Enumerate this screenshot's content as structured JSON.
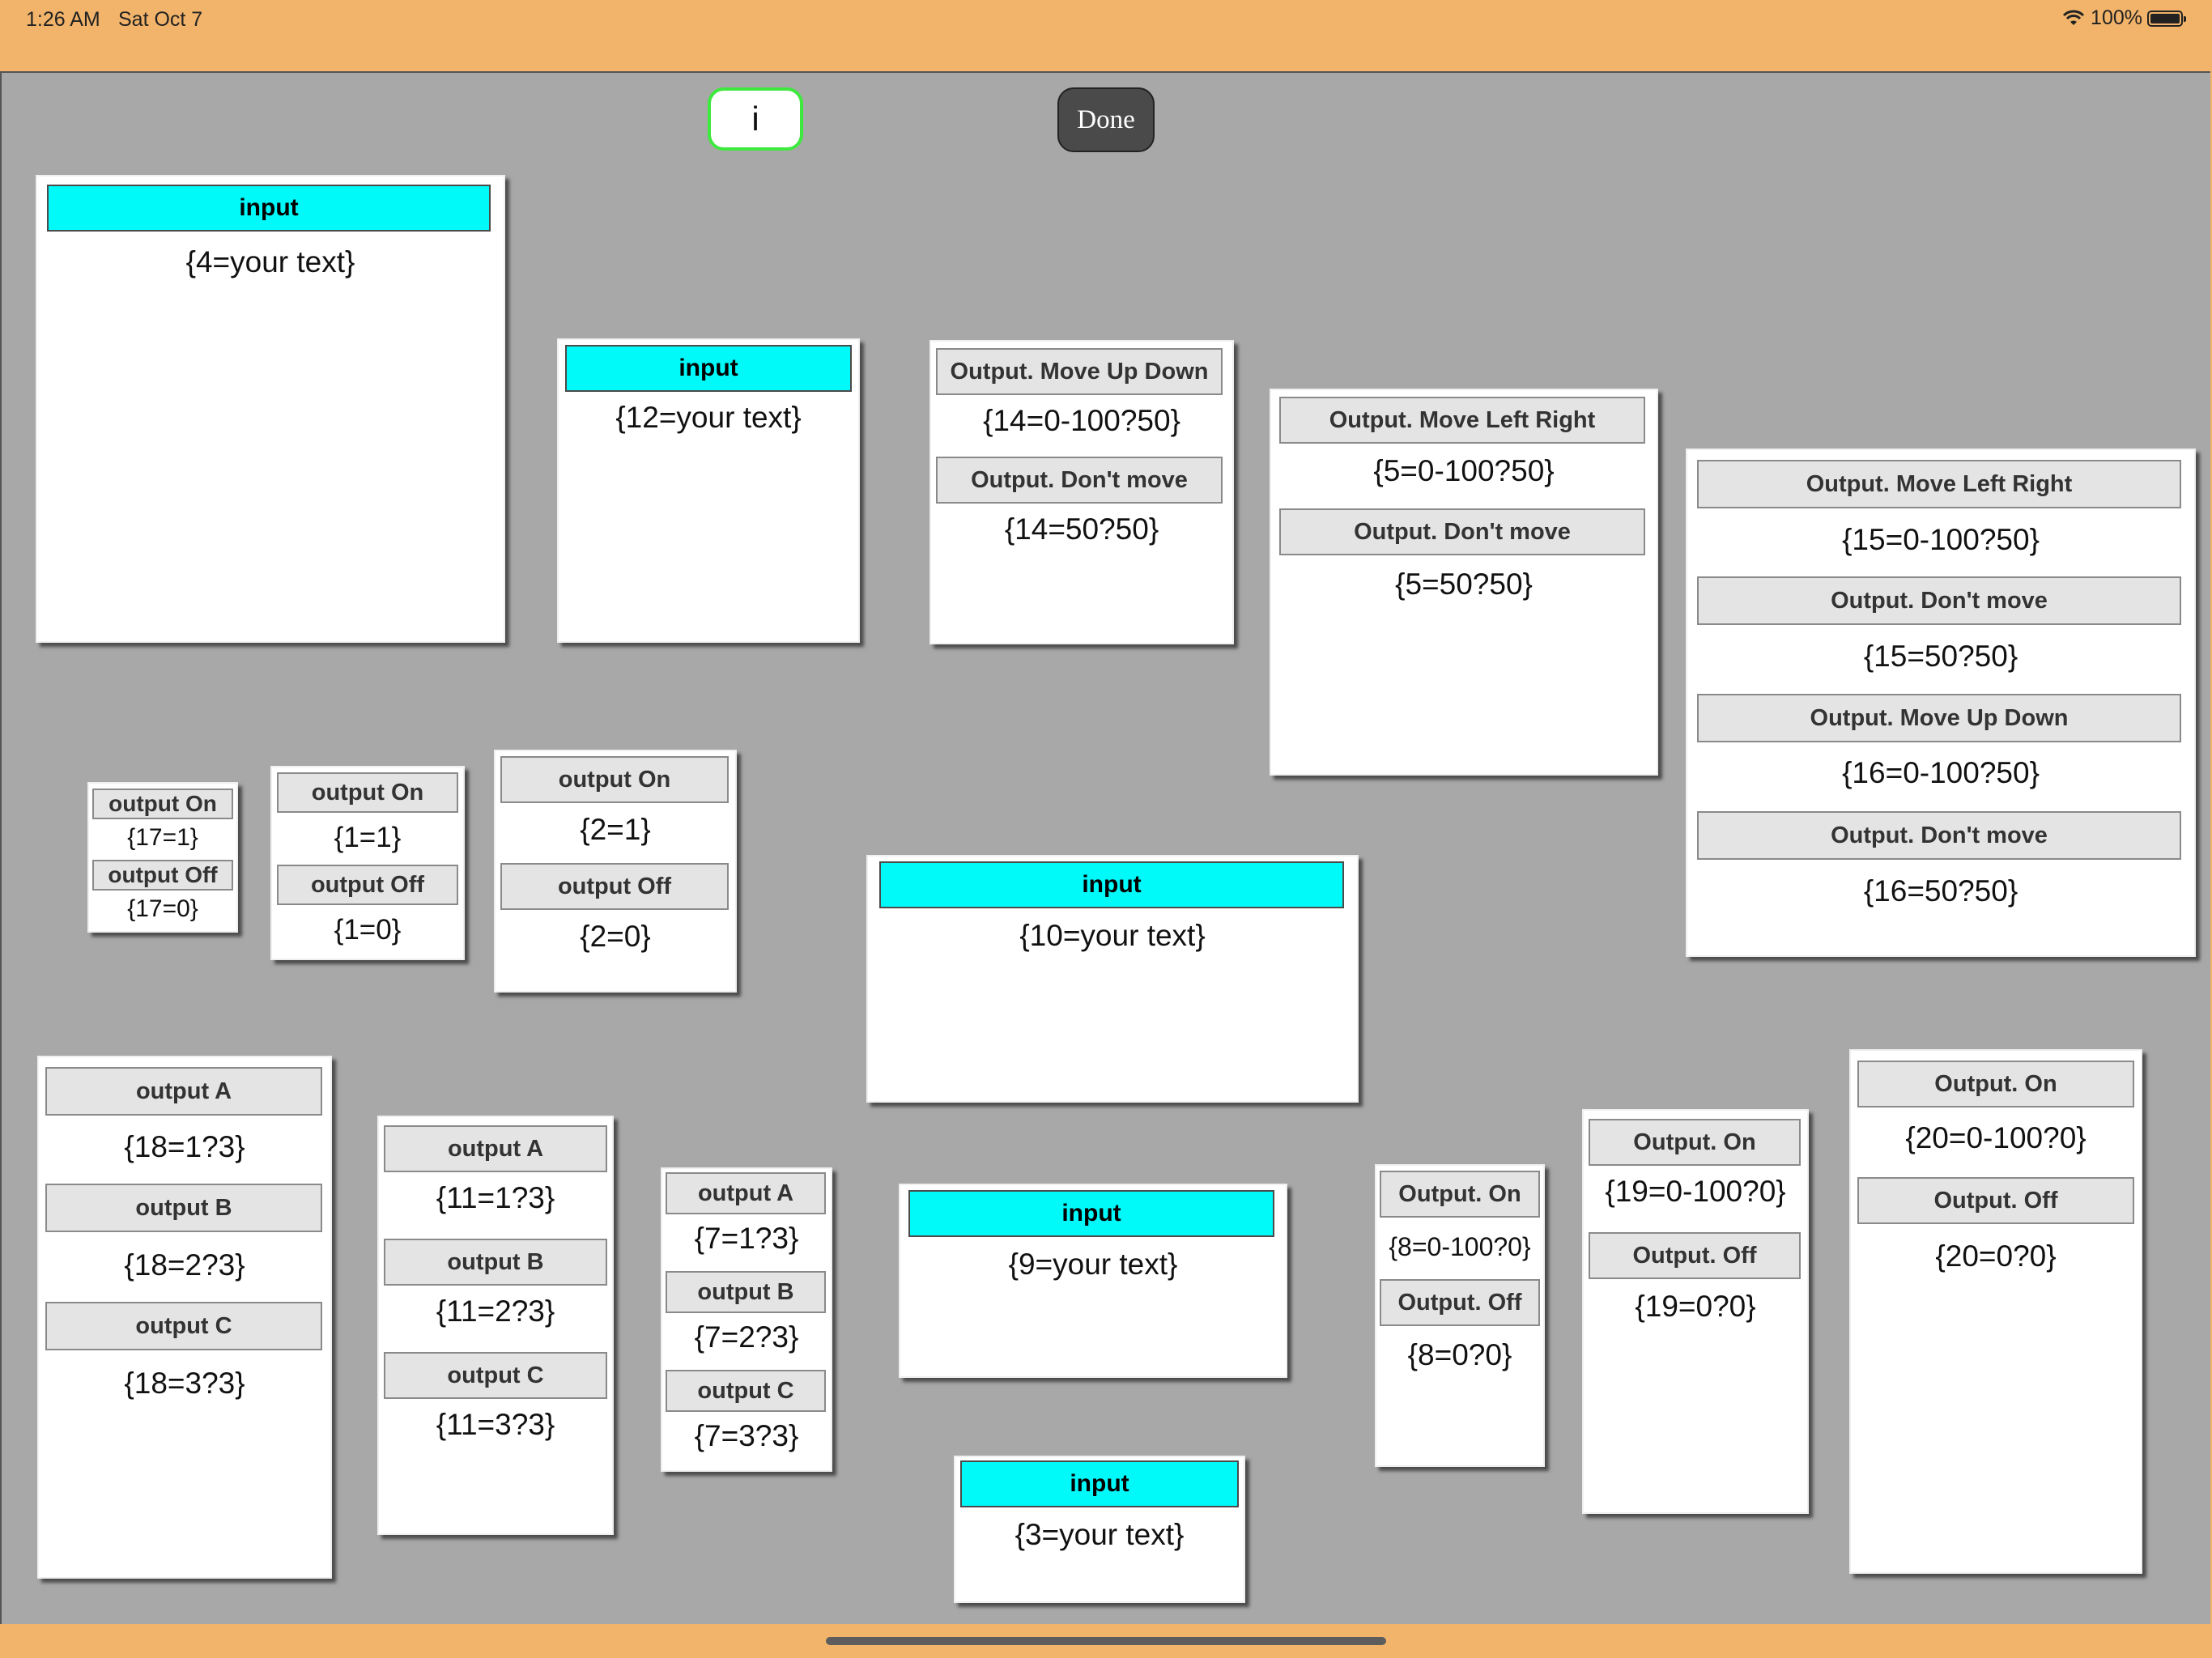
{
  "status_bar": {
    "time": "1:26 AM",
    "date": "Sat Oct 7",
    "battery": "100%"
  },
  "toolbar": {
    "info_label": "i",
    "done_label": "Done"
  },
  "colors": {
    "input_header": "#00f9f9",
    "output_header": "#e4e4e4",
    "canvas": "#a8a8a8",
    "bar": "#f2b46a",
    "info_border": "#3ee93e"
  },
  "panels": {
    "p4": {
      "h0": "input",
      "v0": "{4=your text}"
    },
    "p12": {
      "h0": "input",
      "v0": "{12=your text}"
    },
    "p14": {
      "h0": "Output. Move Up Down",
      "v0": "{14=0-100?50}",
      "h1": "Output. Don't move",
      "v1": "{14=50?50}"
    },
    "p5": {
      "h0": "Output. Move Left Right",
      "v0": "{5=0-100?50}",
      "h1": "Output. Don't move",
      "v1": "{5=50?50}"
    },
    "p15": {
      "h0": "Output. Move Left Right",
      "v0": "{15=0-100?50}",
      "h1": "Output. Don't move",
      "v1": "{15=50?50}",
      "h2": "Output. Move Up Down",
      "v2": "{16=0-100?50}",
      "h3": "Output. Don't move",
      "v3": "{16=50?50}"
    },
    "p17": {
      "h0": "output On",
      "v0": "{17=1}",
      "h1": "output Off",
      "v1": "{17=0}"
    },
    "p1": {
      "h0": "output On",
      "v0": "{1=1}",
      "h1": "output Off",
      "v1": "{1=0}"
    },
    "p2": {
      "h0": "output On",
      "v0": "{2=1}",
      "h1": "output Off",
      "v1": "{2=0}"
    },
    "p10": {
      "h0": "input",
      "v0": "{10=your text}"
    },
    "p18": {
      "h0": "output A",
      "v0": "{18=1?3}",
      "h1": "output B",
      "v1": "{18=2?3}",
      "h2": "output C",
      "v2": "{18=3?3}"
    },
    "p11": {
      "h0": "output A",
      "v0": "{11=1?3}",
      "h1": "output B",
      "v1": "{11=2?3}",
      "h2": "output C",
      "v2": "{11=3?3}"
    },
    "p7": {
      "h0": "output A",
      "v0": "{7=1?3}",
      "h1": "output B",
      "v1": "{7=2?3}",
      "h2": "output C",
      "v2": "{7=3?3}"
    },
    "p9": {
      "h0": "input",
      "v0": "{9=your text}"
    },
    "p3": {
      "h0": "input",
      "v0": "{3=your text}"
    },
    "p8": {
      "h0": "Output. On",
      "v0": "{8=0-100?0}",
      "h1": "Output. Off",
      "v1": "{8=0?0}"
    },
    "p19": {
      "h0": "Output. On",
      "v0": "{19=0-100?0}",
      "h1": "Output. Off",
      "v1": "{19=0?0}"
    },
    "p20": {
      "h0": "Output. On",
      "v0": "{20=0-100?0}",
      "h1": "Output. Off",
      "v1": "{20=0?0}"
    }
  }
}
